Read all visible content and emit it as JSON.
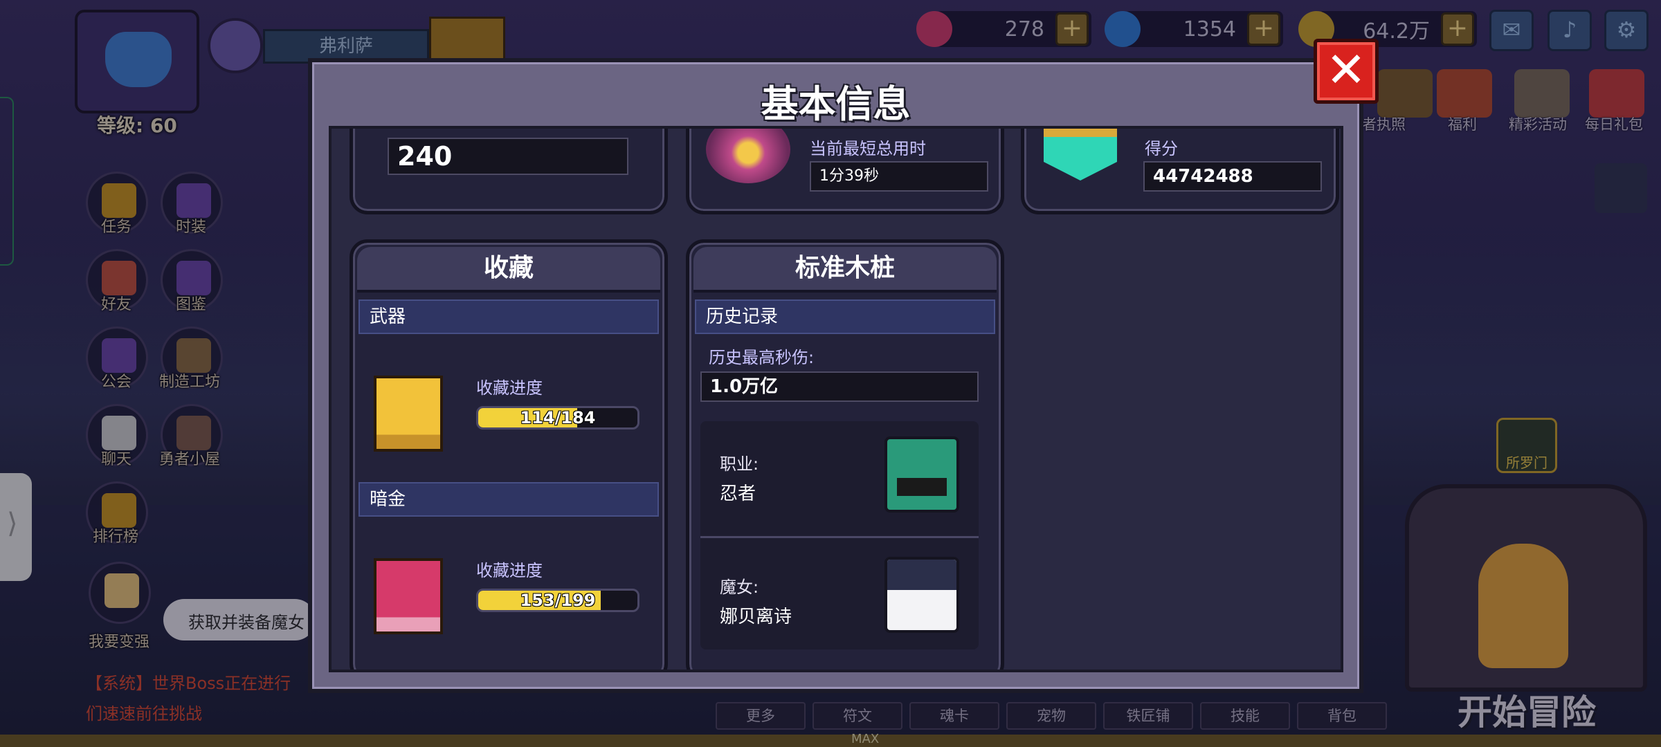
{
  "hud": {
    "player_name": "弗利萨",
    "level_text": "等级: 60",
    "hearts": "278",
    "gems": "1354",
    "gold": "64.2万",
    "mail_icon": "mail-icon",
    "sound_icon": "speaker-icon",
    "settings_icon": "gear-icon"
  },
  "left_menu": [
    {
      "label": "任务"
    },
    {
      "label": "时装"
    },
    {
      "label": "好友"
    },
    {
      "label": "图鉴"
    },
    {
      "label": "公会"
    },
    {
      "label": "制造工坊"
    },
    {
      "label": "聊天"
    },
    {
      "label": "勇者小屋"
    },
    {
      "label": "排行榜"
    },
    {
      "label": "我要变强"
    }
  ],
  "top_right_menu": [
    {
      "label": "者执照"
    },
    {
      "label": "福利"
    },
    {
      "label": "精彩活动"
    },
    {
      "label": "每日礼包"
    }
  ],
  "right_side": {
    "portal_label": "所罗门",
    "start_label": "开始冒险"
  },
  "chat": {
    "line1": "【系统】世界Boss正在进行",
    "line2": "们速速前往挑战",
    "tip": "获取并装备魔女"
  },
  "bottom_tabs": [
    "更多",
    "符文",
    "魂卡",
    "宠物",
    "铁匠铺",
    "技能",
    "背包"
  ],
  "bottom_max": "MAX",
  "dialog": {
    "title": "基本信息",
    "top_row": {
      "card1_value": "240",
      "card2_label": "当前最短总用时",
      "card2_value": "1分39秒",
      "card3_label": "得分",
      "card3_value": "44742488"
    },
    "collection": {
      "title": "收藏",
      "weapon_section": "武器",
      "weapon_progress_label": "收藏进度",
      "weapon_progress_text": "114/184",
      "weapon_progress": 0.62,
      "dark_section": "暗金",
      "dark_progress_label": "收藏进度",
      "dark_progress_text": "153/199",
      "dark_progress": 0.77
    },
    "dummy": {
      "title": "标准木桩",
      "history_section": "历史记录",
      "best_dps_label": "历史最高秒伤:",
      "best_dps_value": "1.0万亿",
      "class_label": "职业:",
      "class_value": "忍者",
      "witch_label": "魔女:",
      "witch_value": "娜贝离诗"
    }
  },
  "colors": {
    "accent_yellow": "#f2d23a",
    "close_red": "#d9221e",
    "label_purple": "#c9c4ff",
    "section_blue": "#2f3563"
  }
}
